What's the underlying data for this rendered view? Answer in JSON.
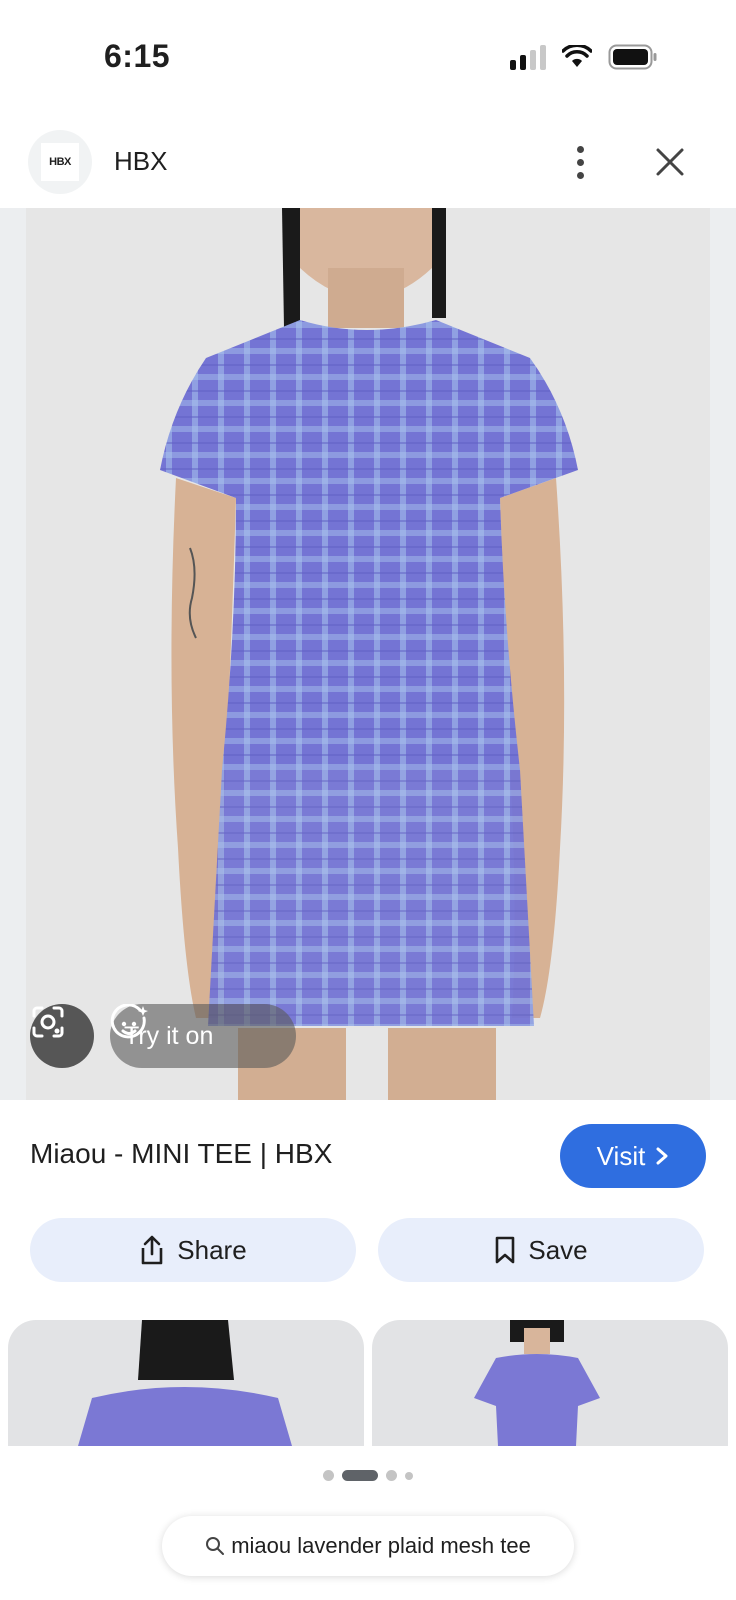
{
  "status_bar": {
    "time": "6:15"
  },
  "header": {
    "logo_text": "HBX",
    "site_name": "HBX",
    "more_icon": "more-vert-icon",
    "close_icon": "close-icon"
  },
  "image_overlay": {
    "lens_icon": "lens-icon",
    "try_on_label": "Try it on"
  },
  "product": {
    "title": "Miaou - MINI TEE | HBX",
    "visit_label": "Visit"
  },
  "actions": {
    "share_label": "Share",
    "save_label": "Save"
  },
  "search": {
    "query": "miaou lavender plaid mesh tee"
  },
  "colors": {
    "accent": "#2f6ee0",
    "action_bg": "#e8eefb",
    "garment": "#7a78d6"
  }
}
